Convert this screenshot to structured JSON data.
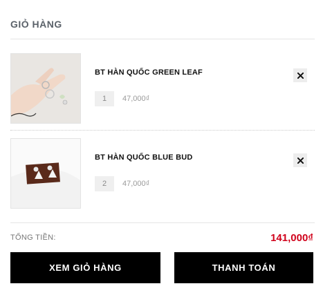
{
  "cart": {
    "title": "GIỎ HÀNG",
    "items": [
      {
        "name": "BT HÀN QUỐC GREEN LEAF",
        "quantity": "1",
        "price": "47,000₫"
      },
      {
        "name": "BT HÀN QUỐC BLUE BUD",
        "quantity": "2",
        "price": "47,000₫"
      }
    ],
    "total_label": "TỔNG TIỀN:",
    "total_value": "141,000₫",
    "buttons": {
      "view_cart": "XEM GIỎ HÀNG",
      "checkout": "THANH TOÁN"
    }
  },
  "colors": {
    "total": "#d0021b",
    "button_bg": "#000000",
    "button_text": "#ffffff"
  },
  "icons": {
    "remove": "close-icon"
  }
}
